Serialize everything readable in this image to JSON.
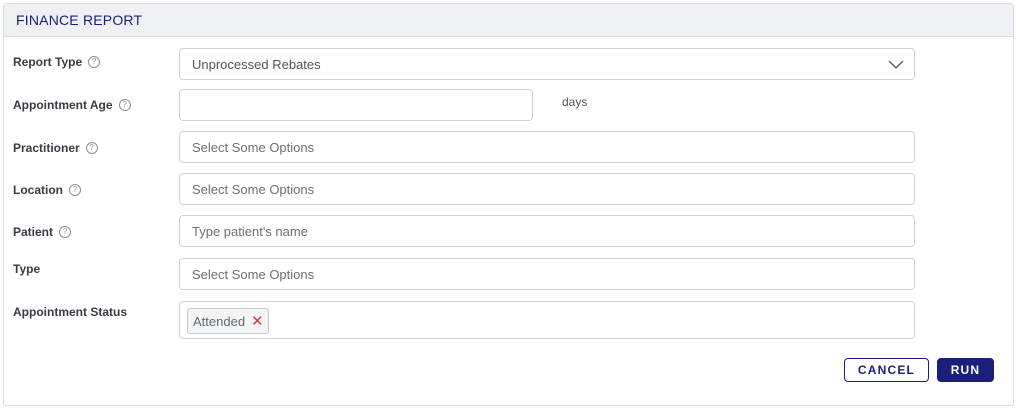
{
  "title": "FINANCE REPORT",
  "fields": {
    "report_type": {
      "label": "Report Type",
      "value": "Unprocessed Rebates",
      "help_icon": "question-circle-icon"
    },
    "appointment_age": {
      "label": "Appointment Age",
      "value": "",
      "unit": "days",
      "help_icon": "question-circle-icon"
    },
    "practitioner": {
      "label": "Practitioner",
      "placeholder": "Select Some Options",
      "help_icon": "question-circle-icon"
    },
    "location": {
      "label": "Location",
      "placeholder": "Select Some Options",
      "help_icon": "question-circle-icon"
    },
    "patient": {
      "label": "Patient",
      "placeholder": "Type patient's name",
      "help_icon": "question-circle-icon"
    },
    "type": {
      "label": "Type",
      "placeholder": "Select Some Options"
    },
    "appointment_status": {
      "label": "Appointment Status",
      "selected_tags": [
        "Attended"
      ],
      "remove_icon": "close-icon"
    }
  },
  "buttons": {
    "cancel": "CANCEL",
    "run": "RUN"
  },
  "colors": {
    "brand": "#1a1f7a",
    "remove": "#d23c3c",
    "header_bg": "#eff0f4"
  }
}
